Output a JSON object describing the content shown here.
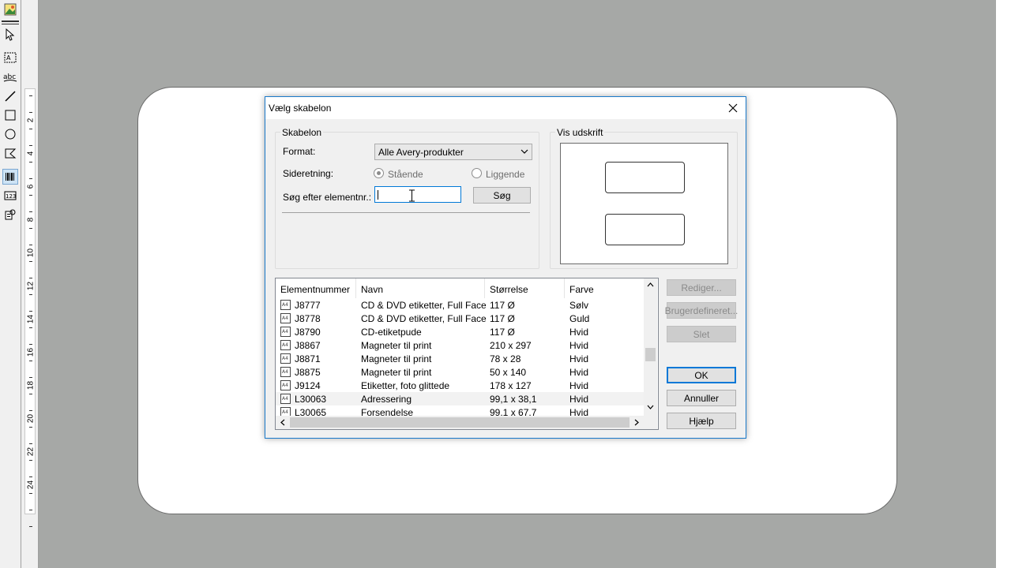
{
  "dialog": {
    "title": "Vælg skabelon",
    "template_group": {
      "legend": "Skabelon",
      "format_label": "Format:",
      "format_value": "Alle Avery-produkter",
      "orientation_label": "Sideretning:",
      "portrait_label": "Stående",
      "landscape_label": "Liggende",
      "portrait_selected": true,
      "search_label": "Søg efter elementnr.:",
      "search_value": "",
      "search_button": "Søg"
    },
    "preview_group": {
      "legend": "Vis udskrift"
    },
    "list": {
      "columns": [
        "Elementnummer",
        "Navn",
        "Størrelse",
        "Farve"
      ],
      "rows": [
        {
          "id": "J8777",
          "name": "CD & DVD etiketter, Full Face",
          "size": "117 Ø",
          "color": "Sølv"
        },
        {
          "id": "J8778",
          "name": "CD & DVD etiketter, Full Face",
          "size": "117 Ø",
          "color": "Guld"
        },
        {
          "id": "J8790",
          "name": "CD-etiketpude",
          "size": "117 Ø",
          "color": "Hvid"
        },
        {
          "id": "J8867",
          "name": "Magneter til print",
          "size": "210 x 297",
          "color": "Hvid"
        },
        {
          "id": "J8871",
          "name": "Magneter til print",
          "size": "78 x 28",
          "color": "Hvid"
        },
        {
          "id": "J8875",
          "name": "Magneter til print",
          "size": "50 x 140",
          "color": "Hvid"
        },
        {
          "id": "J9124",
          "name": "Etiketter, foto glittede",
          "size": "178 x 127",
          "color": "Hvid"
        },
        {
          "id": "L30063",
          "name": "Adressering",
          "size": "99,1 x 38,1",
          "color": "Hvid"
        },
        {
          "id": "L30065",
          "name": "Forsendelse",
          "size": "99,1 x 67,7",
          "color": "Hvid"
        }
      ]
    },
    "buttons": {
      "edit": "Rediger...",
      "custom": "Brugerdefineret...",
      "delete": "Slet",
      "ok": "OK",
      "cancel": "Annuller",
      "help": "Hjælp"
    }
  },
  "ruler": {
    "labels": [
      "2",
      "4",
      "6",
      "8",
      "10",
      "12",
      "14",
      "16",
      "18",
      "20",
      "22",
      "24"
    ]
  },
  "colors": {
    "workspace": "#a6a8a6",
    "dialog_border": "#1979ca",
    "focus_blue": "#0078d7"
  }
}
